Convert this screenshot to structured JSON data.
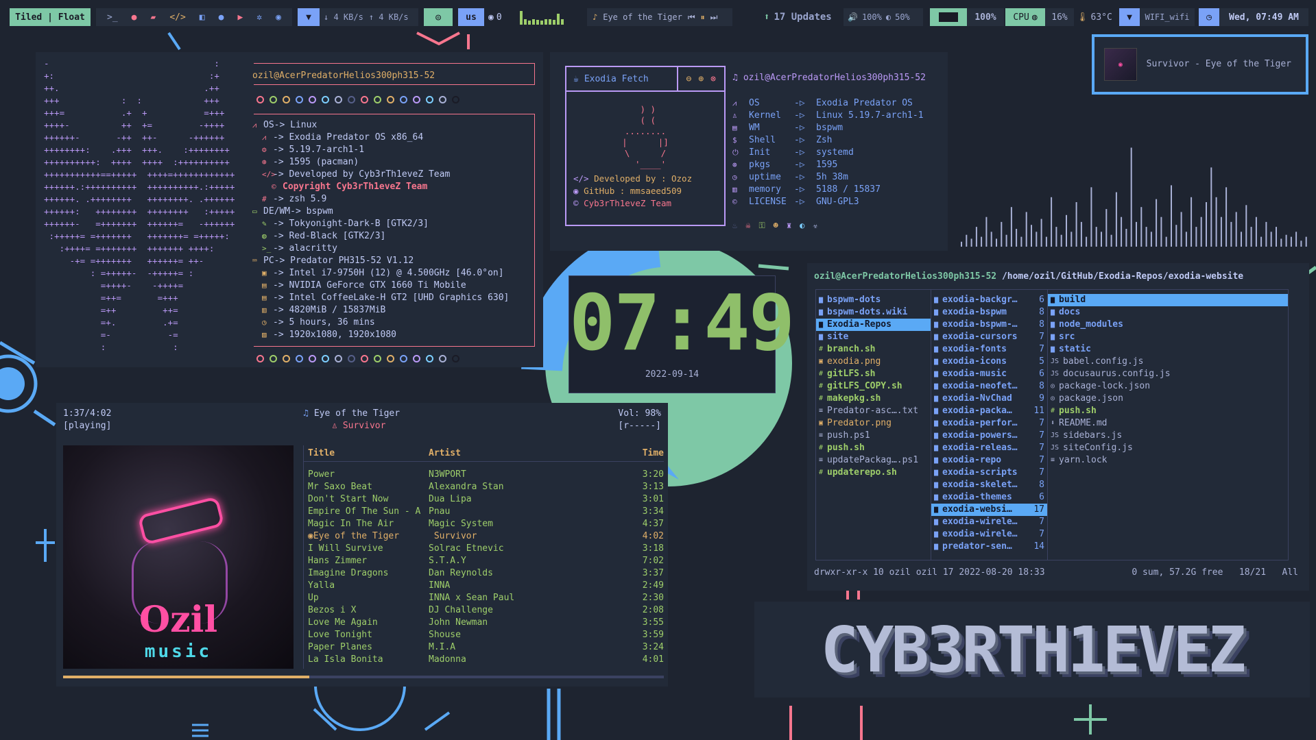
{
  "bar": {
    "layout": "Tiled | Float",
    "launchers": [
      "terminal-icon",
      "firefox-icon",
      "folder-icon",
      "code-icon",
      "vscode-icon",
      "chat-icon",
      "youtube-icon",
      "settings-icon",
      "github-icon"
    ],
    "down": "4 KB/s",
    "up": "4 KB/s",
    "kbd": "us",
    "github_count": "0",
    "song": "Eye of the Tiger",
    "updates": "17 Updates",
    "volume": "100%",
    "brightness": "50%",
    "battery": "100%",
    "cpu_label": "CPU",
    "cpu": "16%",
    "temp": "63°C",
    "wifi": "WIFI_wifi",
    "clock": "Wed, 07:49 AM"
  },
  "notify": {
    "text": "Survivor - Eye of the Tiger"
  },
  "neofetch": {
    "ascii": [
      "-                                :",
      "+:                              :+",
      "++.                            .++",
      "+++            :  :            +++",
      "+++=           .+  +           =+++",
      "++++-          ++  +=         -++++",
      "++++++-       -++  ++-      -++++++",
      "++++++++:    .+++  +++.    :++++++++",
      "++++++++++:  ++++  ++++  :++++++++++",
      "+++++++++++==+++++  ++++=++++++++++++",
      "++++++.:++++++++++  ++++++++++.:+++++",
      "++++++. .++++++++   ++++++++. .++++++",
      "++++++:   ++++++++  ++++++++   :+++++",
      "++++++-   =+++++++  ++++++=   -++++++",
      " :+++++= =+++++++   +++++++= =+++++:",
      "   :++++= =+++++++  +++++++ ++++:",
      "     -+= =+++++++   ++++++= ++-",
      "         : =+++++-  -+++++= :",
      "           =++++-    -++++=",
      "           =++=       =+++",
      "           =++         ++=",
      "           =+.         .+=",
      "           =-           -=",
      "           :             :"
    ],
    "user": "ozil@AcerPredatorHelios300ph315-52",
    "lines": [
      {
        "icon": "arch-icon",
        "text": "OS-> Linux",
        "indent": 0,
        "color": "#f7768e"
      },
      {
        "icon": "arch-icon",
        "text": "-> Exodia Predator OS x86_64",
        "indent": 1,
        "color": "#f7768e"
      },
      {
        "icon": "gear-icon",
        "text": "-> 5.19.7-arch1-1",
        "indent": 1,
        "color": "#f7768e"
      },
      {
        "icon": "package-icon",
        "text": "-> 1595 (pacman)",
        "indent": 1,
        "color": "#f7768e"
      },
      {
        "icon": "code-icon",
        "text": "-> Developed by Cyb3rTh1eveZ Team",
        "indent": 1,
        "color": "#f7768e"
      },
      {
        "icon": "copyright-icon",
        "text": "Copyright Cyb3rTh1eveZ Team",
        "indent": 2,
        "color": "#f7768e",
        "accent": true
      },
      {
        "icon": "hash-icon",
        "text": "-> zsh 5.9",
        "indent": 1,
        "color": "#f7768e"
      },
      {
        "icon": "monitor-icon",
        "text": "DE/WM-> bspwm",
        "indent": 0,
        "color": "#9ece6a"
      },
      {
        "icon": "paint-icon",
        "text": "-> Tokyonight-Dark-B [GTK2/3]",
        "indent": 1,
        "color": "#9ece6a"
      },
      {
        "icon": "palette-icon",
        "text": "-> Red-Black [GTK2/3]",
        "indent": 1,
        "color": "#9ece6a"
      },
      {
        "icon": "terminal-icon",
        "text": "-> alacritty",
        "indent": 1,
        "color": "#9ece6a"
      },
      {
        "icon": "laptop-icon",
        "text": "PC-> Predator PH315-52 V1.12",
        "indent": 0,
        "color": "#e0af68"
      },
      {
        "icon": "cpu-icon",
        "text": "-> Intel i7-9750H (12) @ 4.500GHz [46.0°on]",
        "indent": 1,
        "color": "#e0af68"
      },
      {
        "icon": "gpu-icon",
        "text": "-> NVIDIA GeForce GTX 1660 Ti Mobile",
        "indent": 1,
        "color": "#e0af68"
      },
      {
        "icon": "gpu-icon",
        "text": "-> Intel CoffeeLake-H GT2 [UHD Graphics 630]",
        "indent": 1,
        "color": "#e0af68"
      },
      {
        "icon": "memory-icon",
        "text": "-> 4820MiB / 15837MiB",
        "indent": 1,
        "color": "#e0af68"
      },
      {
        "icon": "clock-icon",
        "text": "-> 5 hours, 36 mins",
        "indent": 1,
        "color": "#e0af68"
      },
      {
        "icon": "image-icon",
        "text": "-> 1920x1080, 1920x1080",
        "indent": 1,
        "color": "#e0af68"
      }
    ],
    "dot_colors": [
      "#f7768e",
      "#9ece6a",
      "#e0af68",
      "#7aa2f7",
      "#bb9af7",
      "#7dcfff",
      "#a9b1d6",
      "#565f89",
      "#f7768e",
      "#9ece6a",
      "#e0af68",
      "#7aa2f7",
      "#bb9af7",
      "#7dcfff",
      "#a9b1d6",
      "#1a1b26"
    ]
  },
  "fetch": {
    "title": "Exodia Fetch",
    "art": [
      " ) )",
      " ( (",
      "........",
      "|      |]",
      "\\      /",
      "  '____'"
    ],
    "dev": "Developed by : Ozoz",
    "github": "GitHub : mmsaeed509",
    "team": "Cyb3rTh1eveZ Team",
    "user": "ozil@AcerPredatorHelios300ph315-52",
    "rows": [
      {
        "k": "OS",
        "v": "Exodia Predator OS"
      },
      {
        "k": "Kernel",
        "v": "Linux 5.19.7-arch1-1"
      },
      {
        "k": "WM",
        "v": "bspwm"
      },
      {
        "k": "Shell",
        "v": "Zsh"
      },
      {
        "k": "Init",
        "v": "systemd"
      },
      {
        "k": "pkgs",
        "v": "1595"
      },
      {
        "k": "uptime",
        "v": "5h 38m"
      },
      {
        "k": "memory",
        "v": "5188 / 15837"
      },
      {
        "k": "LICENSE",
        "v": "GNU-GPL3"
      }
    ],
    "arrow": "-▷"
  },
  "clock": {
    "time": "07:49",
    "date": "2022-09-14"
  },
  "visualizer": {
    "values": [
      0.05,
      0.12,
      0.08,
      0.2,
      0.1,
      0.3,
      0.15,
      0.08,
      0.25,
      0.12,
      0.4,
      0.18,
      0.1,
      0.35,
      0.22,
      0.15,
      0.28,
      0.1,
      0.5,
      0.2,
      0.12,
      0.32,
      0.15,
      0.45,
      0.25,
      0.1,
      0.6,
      0.2,
      0.15,
      0.38,
      0.12,
      0.55,
      0.3,
      0.18,
      1.0,
      0.25,
      0.4,
      0.2,
      0.15,
      0.48,
      0.3,
      0.1,
      0.62,
      0.22,
      0.35,
      0.15,
      0.5,
      0.2,
      0.3,
      0.45,
      0.8,
      0.5,
      0.3,
      0.6,
      0.25,
      0.35,
      0.15,
      0.42,
      0.2,
      0.3,
      0.1,
      0.25,
      0.15,
      0.2,
      0.08,
      0.12,
      0.1,
      0.15,
      0.06,
      0.1
    ]
  },
  "ranger": {
    "path_user": "ozil@AcerPredatorHelios300ph315-52",
    "path": "/home/ozil/GitHub/Exodia-Repos/exodia-website",
    "col1": [
      {
        "n": "bspwm-dots",
        "t": "dir"
      },
      {
        "n": "bspwm-dots.wiki",
        "t": "dir"
      },
      {
        "n": "Exodia-Repos",
        "t": "dir",
        "sel": true
      },
      {
        "n": "site",
        "t": "dir"
      },
      {
        "n": "branch.sh",
        "t": "exe"
      },
      {
        "n": "exodia.png",
        "t": "img"
      },
      {
        "n": "gitLFS.sh",
        "t": "exe"
      },
      {
        "n": "gitLFS_COPY.sh",
        "t": "exe"
      },
      {
        "n": "makepkg.sh",
        "t": "exe"
      },
      {
        "n": "Predator-asc….txt",
        "t": "txt"
      },
      {
        "n": "Predator.png",
        "t": "img"
      },
      {
        "n": "push.ps1",
        "t": "txt"
      },
      {
        "n": "push.sh",
        "t": "exe"
      },
      {
        "n": "updatePackag….ps1",
        "t": "txt"
      },
      {
        "n": "updaterepo.sh",
        "t": "exe"
      }
    ],
    "col2": [
      {
        "n": "exodia-backgr…",
        "c": "6"
      },
      {
        "n": "exodia-bspwm",
        "c": "8"
      },
      {
        "n": "exodia-bspwm-…",
        "c": "8"
      },
      {
        "n": "exodia-cursors",
        "c": "7"
      },
      {
        "n": "exodia-fonts",
        "c": "7"
      },
      {
        "n": "exodia-icons",
        "c": "5"
      },
      {
        "n": "exodia-music",
        "c": "6"
      },
      {
        "n": "exodia-neofet…",
        "c": "8"
      },
      {
        "n": "exodia-NvChad",
        "c": "9"
      },
      {
        "n": "exodia-packa…",
        "c": "11"
      },
      {
        "n": "exodia-perfor…",
        "c": "7"
      },
      {
        "n": "exodia-powers…",
        "c": "7"
      },
      {
        "n": "exodia-releas…",
        "c": "7"
      },
      {
        "n": "exodia-repo",
        "c": "7"
      },
      {
        "n": "exodia-scripts",
        "c": "7"
      },
      {
        "n": "exodia-skelet…",
        "c": "8"
      },
      {
        "n": "exodia-themes",
        "c": "6"
      },
      {
        "n": "exodia-websi…",
        "c": "17",
        "sel": true
      },
      {
        "n": "exodia-wirele…",
        "c": "7"
      },
      {
        "n": "exodia-wirele…",
        "c": "7"
      },
      {
        "n": "predator-sen…",
        "c": "14"
      }
    ],
    "col3": [
      {
        "n": "build",
        "t": "dir",
        "sel": true
      },
      {
        "n": "docs",
        "t": "dir"
      },
      {
        "n": "node_modules",
        "t": "dir"
      },
      {
        "n": "src",
        "t": "dir"
      },
      {
        "n": "static",
        "t": "dir"
      },
      {
        "n": "babel.config.js",
        "t": "js"
      },
      {
        "n": "docusaurus.config.js",
        "t": "js"
      },
      {
        "n": "package-lock.json",
        "t": "json"
      },
      {
        "n": "package.json",
        "t": "json"
      },
      {
        "n": "push.sh",
        "t": "exe"
      },
      {
        "n": "README.md",
        "t": "md"
      },
      {
        "n": "sidebars.js",
        "t": "js"
      },
      {
        "n": "siteConfig.js",
        "t": "js"
      },
      {
        "n": "yarn.lock",
        "t": "txt"
      }
    ],
    "status_left": "drwxr-xr-x 10 ozil ozil 17 2022-08-20 18:33",
    "status_right": "0 sum, 57.2G free   18/21   All"
  },
  "player": {
    "elapsed": "1:37/4:02",
    "state": "[playing]",
    "song": "Eye of the Tiger",
    "artist": "Survivor",
    "vol": "Vol: 98%",
    "flags": "[r-----]",
    "progress": 0.41,
    "album_title": "Ozil",
    "album_sub": "music",
    "headers": {
      "title": "Title",
      "artist": "Artist",
      "time": "Time"
    },
    "tracks": [
      {
        "t": "Power",
        "a": "N3WPORT",
        "d": "3:20"
      },
      {
        "t": "Mr Saxo Beat",
        "a": "Alexandra Stan",
        "d": "3:13"
      },
      {
        "t": "Don't Start Now",
        "a": "Dua Lipa",
        "d": "3:01"
      },
      {
        "t": "Empire Of The Sun - A",
        "a": "Pnau",
        "d": "3:34"
      },
      {
        "t": "Magic In The Air",
        "a": "Magic System",
        "d": "4:37"
      },
      {
        "t": "Eye of the Tiger",
        "a": "Survivor",
        "d": "4:02",
        "playing": true
      },
      {
        "t": "I Will Survive",
        "a": "Solrac Etnevic",
        "d": "3:18"
      },
      {
        "t": "Hans Zimmer",
        "a": "S.T.A.Y",
        "d": "7:02"
      },
      {
        "t": "Imagine Dragons",
        "a": "Dan Reynolds",
        "d": "3:37"
      },
      {
        "t": "Yalla",
        "a": "INNA",
        "d": "2:49"
      },
      {
        "t": "Up",
        "a": "INNA x Sean Paul",
        "d": "2:30"
      },
      {
        "t": "Bezos i X",
        "a": "DJ Challenge",
        "d": "2:08"
      },
      {
        "t": "Love Me Again",
        "a": "John Newman",
        "d": "3:55"
      },
      {
        "t": "Love Tonight",
        "a": "Shouse",
        "d": "3:59"
      },
      {
        "t": "Paper Planes",
        "a": "M.I.A",
        "d": "3:24"
      },
      {
        "t": "La Isla Bonita",
        "a": "Madonna",
        "d": "4:01"
      }
    ]
  },
  "banner": {
    "text": "CYB3RTH1EVEZ"
  }
}
